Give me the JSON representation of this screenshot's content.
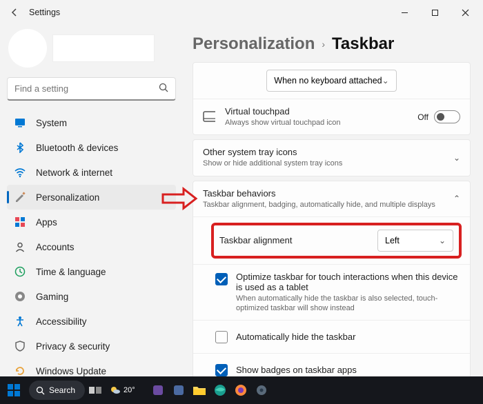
{
  "window": {
    "title": "Settings"
  },
  "search": {
    "placeholder": "Find a setting"
  },
  "nav": [
    {
      "label": "System"
    },
    {
      "label": "Bluetooth & devices"
    },
    {
      "label": "Network & internet"
    },
    {
      "label": "Personalization",
      "selected": true
    },
    {
      "label": "Apps"
    },
    {
      "label": "Accounts"
    },
    {
      "label": "Time & language"
    },
    {
      "label": "Gaming"
    },
    {
      "label": "Accessibility"
    },
    {
      "label": "Privacy & security"
    },
    {
      "label": "Windows Update"
    }
  ],
  "breadcrumb": {
    "parent": "Personalization",
    "sep": "›",
    "current": "Taskbar"
  },
  "kb_dropdown": "When no keyboard attached",
  "vt": {
    "title": "Virtual touchpad",
    "sub": "Always show virtual touchpad icon",
    "state": "Off"
  },
  "tray": {
    "title": "Other system tray icons",
    "sub": "Show or hide additional system tray icons"
  },
  "beh": {
    "title": "Taskbar behaviors",
    "sub": "Taskbar alignment, badging, automatically hide, and multiple displays"
  },
  "align": {
    "label": "Taskbar alignment",
    "value": "Left"
  },
  "opt_touch": {
    "label": "Optimize taskbar for touch interactions when this device is used as a tablet",
    "sub": "When automatically hide the taskbar is also selected, touch-optimized taskbar will show instead"
  },
  "autohide": {
    "label": "Automatically hide the taskbar"
  },
  "badges": {
    "label": "Show badges on taskbar apps"
  },
  "taskbar": {
    "search": "Search",
    "temp": "20°"
  }
}
